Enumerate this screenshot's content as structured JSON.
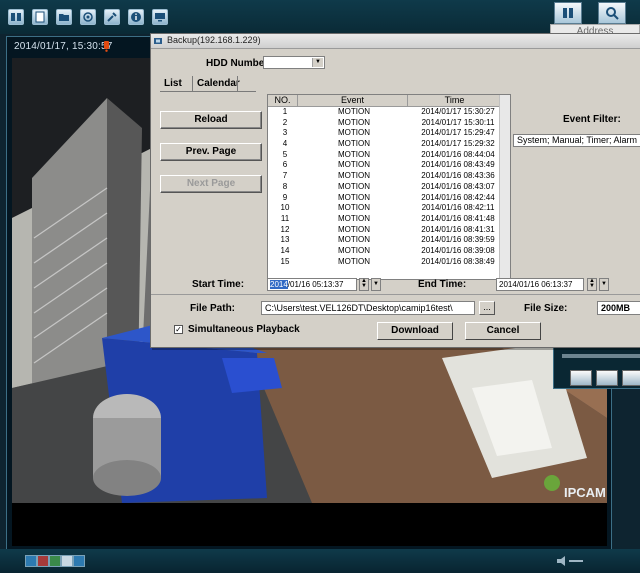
{
  "video": {
    "timestamp": "2014/01/17, 15:30:57",
    "overlay_label": "IPCAM"
  },
  "header": {
    "address_column": "Address"
  },
  "dialog": {
    "title": "Backup(192.168.1.229)",
    "hdd_number_label": "HDD Number:",
    "hdd_number_value": "",
    "tabs": [
      {
        "label": "List",
        "active": true
      },
      {
        "label": "Calendar",
        "active": false
      }
    ],
    "buttons": {
      "reload": "Reload",
      "prev_page": "Prev. Page",
      "next_page": "Next Page",
      "browse": "...",
      "download": "Download",
      "cancel": "Cancel"
    },
    "table": {
      "columns": [
        "NO.",
        "Event",
        "Time"
      ],
      "rows": [
        {
          "no": "1",
          "event": "MOTION",
          "time": "2014/01/17 15:30:27"
        },
        {
          "no": "2",
          "event": "MOTION",
          "time": "2014/01/17 15:30:11"
        },
        {
          "no": "3",
          "event": "MOTION",
          "time": "2014/01/17 15:29:47"
        },
        {
          "no": "4",
          "event": "MOTION",
          "time": "2014/01/17 15:29:32"
        },
        {
          "no": "5",
          "event": "MOTION",
          "time": "2014/01/16 08:44:04"
        },
        {
          "no": "6",
          "event": "MOTION",
          "time": "2014/01/16 08:43:49"
        },
        {
          "no": "7",
          "event": "MOTION",
          "time": "2014/01/16 08:43:36"
        },
        {
          "no": "8",
          "event": "MOTION",
          "time": "2014/01/16 08:43:07"
        },
        {
          "no": "9",
          "event": "MOTION",
          "time": "2014/01/16 08:42:44"
        },
        {
          "no": "10",
          "event": "MOTION",
          "time": "2014/01/16 08:42:11"
        },
        {
          "no": "11",
          "event": "MOTION",
          "time": "2014/01/16 08:41:48"
        },
        {
          "no": "12",
          "event": "MOTION",
          "time": "2014/01/16 08:41:31"
        },
        {
          "no": "13",
          "event": "MOTION",
          "time": "2014/01/16 08:39:59"
        },
        {
          "no": "14",
          "event": "MOTION",
          "time": "2014/01/16 08:39:08"
        },
        {
          "no": "15",
          "event": "MOTION",
          "time": "2014/01/16 08:38:49"
        }
      ]
    },
    "event_filter_label": "Event Filter:",
    "event_filter_value": "System; Manual; Timer; Alarm",
    "start_time_label": "Start Time:",
    "start_time_year": "2014",
    "start_time_rest": "/01/16 05:13:37",
    "end_time_label": "End Time:",
    "end_time_value": "2014/01/16 06:13:37",
    "file_path_label": "File Path:",
    "file_path_value": "C:\\Users\\test.VEL126DT\\Desktop\\camip16test\\",
    "file_size_label": "File Size:",
    "file_size_value": "200MB",
    "simultaneous_label": "Simultaneous Playback",
    "simultaneous_checked": true
  },
  "colors": {
    "dialog_bg": "#d4d0c8",
    "app_bg": "#0e2430",
    "selection": "#316ac5"
  }
}
